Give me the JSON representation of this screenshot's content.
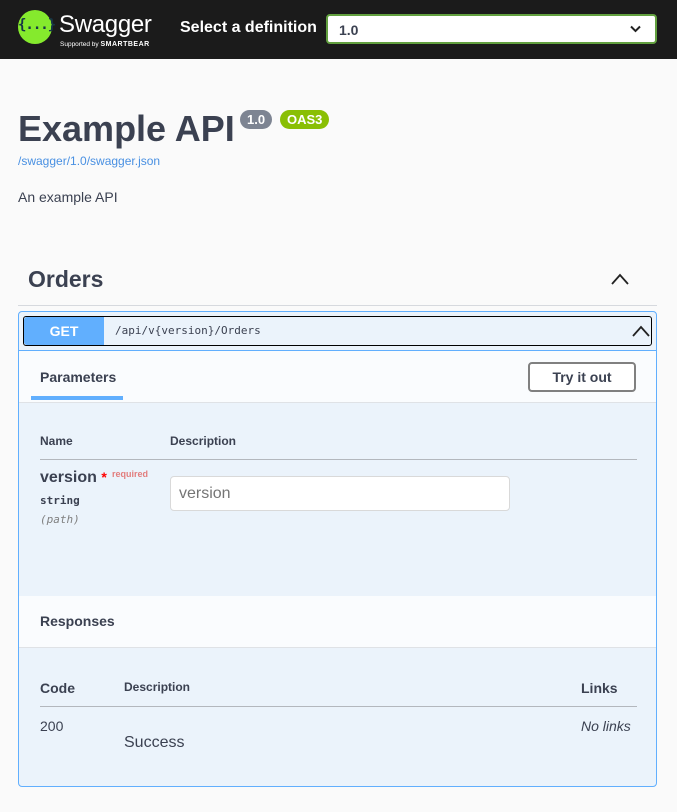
{
  "topbar": {
    "logo_mark": "{...}",
    "logo_text": "Swagger",
    "logo_sub_prefix": "Supported by",
    "logo_sub_brand": "SMARTBEAR",
    "select_label": "Select a definition",
    "select_value": "1.0"
  },
  "info": {
    "title": "Example API",
    "version_badge": "1.0",
    "oas_badge": "OAS3",
    "spec_link": "/swagger/1.0/swagger.json",
    "description": "An example API"
  },
  "tag": {
    "name": "Orders"
  },
  "operation": {
    "method": "GET",
    "path": "/api/v{version}/Orders",
    "parameters_label": "Parameters",
    "try_it_out_label": "Try it out",
    "param_columns": [
      "Name",
      "Description"
    ],
    "parameter": {
      "name": "version",
      "required_star": "*",
      "required_label": "required",
      "type": "string",
      "location": "(path)",
      "placeholder": "version"
    },
    "responses_label": "Responses",
    "response_columns": [
      "Code",
      "Description",
      "Links"
    ],
    "response": {
      "code": "200",
      "description": "Success",
      "links": "No links"
    }
  },
  "colors": {
    "topbar": "#1b1b1b",
    "logo_green": "#85ea2d",
    "select_border": "#62a03f",
    "get_method": "#61affe",
    "opblock_bg": "#ebf3fb",
    "version_badge": "#7d8492",
    "oas_badge": "#89bf04",
    "link": "#4990e2"
  }
}
